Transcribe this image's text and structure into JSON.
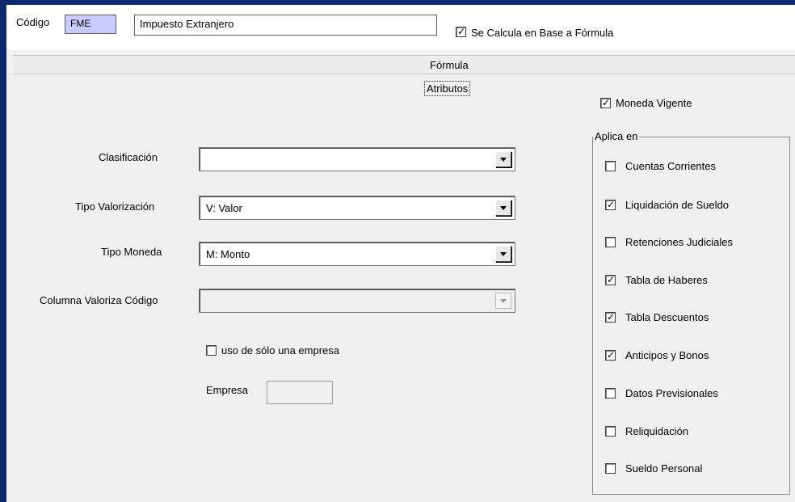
{
  "header": {
    "codigo_label": "Código",
    "codigo_value": "FME",
    "nombre_value": "Impuesto Extranjero",
    "formula_checkbox": {
      "label": "Se Calcula en Base a Fórmula",
      "checked": true
    }
  },
  "tabs": {
    "formula": "Fórmula",
    "atributos": "Atributos"
  },
  "form": {
    "clasificacion": {
      "label": "Clasificación",
      "value": ""
    },
    "tipo_valorizacion": {
      "label": "Tipo Valorización",
      "value": "V: Valor"
    },
    "tipo_moneda": {
      "label": "Tipo Moneda",
      "value": "M: Monto"
    },
    "columna_valoriza": {
      "label": "Columna Valoriza Código",
      "value": ""
    },
    "una_empresa": {
      "label": "uso de sólo una empresa",
      "checked": false
    },
    "empresa_label": "Empresa"
  },
  "moneda_vigente": {
    "label": "Moneda Vigente",
    "checked": true
  },
  "aplica_en": {
    "title": "Aplica en",
    "items": [
      {
        "label": "Cuentas Corrientes",
        "checked": false
      },
      {
        "label": "Liquidación de Sueldo",
        "checked": true
      },
      {
        "label": "Retenciones Judiciales",
        "checked": false
      },
      {
        "label": "Tabla de Haberes",
        "checked": true
      },
      {
        "label": "Tabla Descuentos",
        "checked": true
      },
      {
        "label": "Anticipos y Bonos",
        "checked": true
      },
      {
        "label": "Datos Previsionales",
        "checked": false
      },
      {
        "label": "Reliquidación",
        "checked": false
      },
      {
        "label": "Sueldo Personal",
        "checked": false
      }
    ]
  }
}
